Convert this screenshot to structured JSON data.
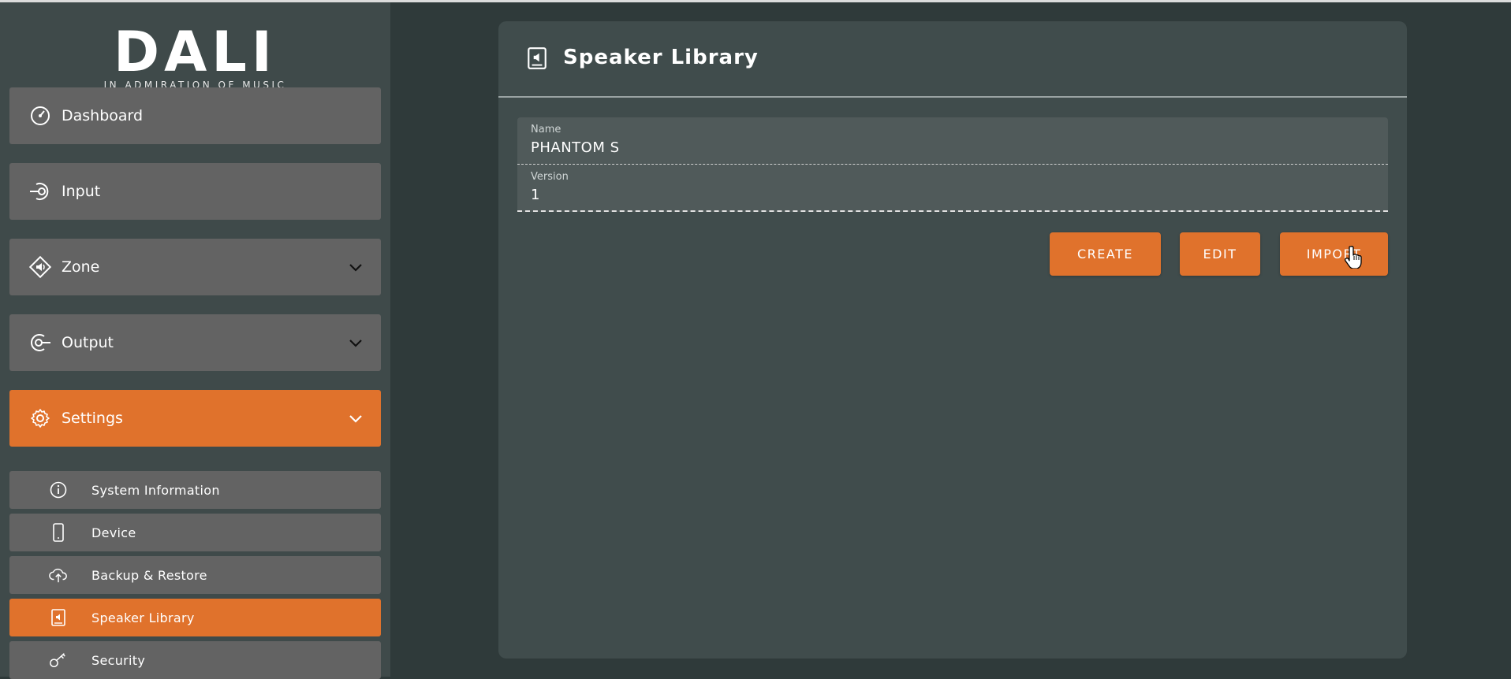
{
  "brand": {
    "logo_text": "DALI",
    "tagline": "IN ADMIRATION OF MUSIC",
    "accent_color": "#e0722c"
  },
  "sidebar": {
    "items": [
      {
        "label": "Dashboard",
        "icon": "gauge-icon"
      },
      {
        "label": "Input",
        "icon": "input-icon"
      },
      {
        "label": "Zone",
        "icon": "zone-speaker-icon"
      },
      {
        "label": "Output",
        "icon": "output-icon"
      },
      {
        "label": "Settings",
        "icon": "gear-icon"
      }
    ],
    "settings_sub": [
      {
        "label": "System Information",
        "icon": "info-icon"
      },
      {
        "label": "Device",
        "icon": "phone-icon"
      },
      {
        "label": "Backup & Restore",
        "icon": "cloud-upload-icon"
      },
      {
        "label": "Speaker Library",
        "icon": "speaker-book-icon"
      },
      {
        "label": "Security",
        "icon": "key-icon"
      }
    ]
  },
  "main": {
    "title": "Speaker Library",
    "fields": {
      "name_label": "Name",
      "name_value": "PHANTOM S",
      "version_label": "Version",
      "version_value": "1"
    },
    "buttons": {
      "create": "CREATE",
      "edit": "EDIT",
      "import": "IMPORT"
    }
  }
}
